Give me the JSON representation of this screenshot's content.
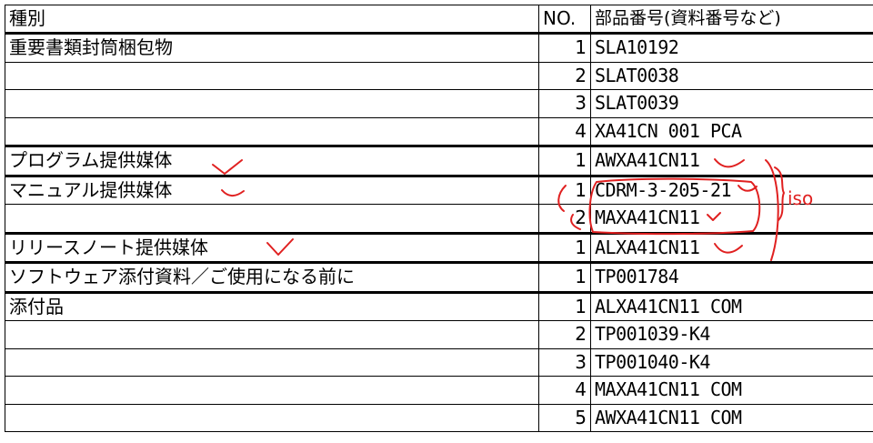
{
  "headers": {
    "type": "種別",
    "no": "NO.",
    "part": "部品番号(資料番号など)"
  },
  "rows": [
    {
      "type": "重要書類封筒梱包物",
      "no": "1",
      "part": "SLA10192"
    },
    {
      "type": "",
      "no": "2",
      "part": "SLAT0038"
    },
    {
      "type": "",
      "no": "3",
      "part": "SLAT0039"
    },
    {
      "type": "",
      "no": "4",
      "part": "XA41CN 001 PCA"
    },
    {
      "type": "プログラム提供媒体",
      "no": "1",
      "part": "AWXA41CN11"
    },
    {
      "type": "マニュアル提供媒体",
      "no": "1",
      "part": "CDRM-3-205-21"
    },
    {
      "type": "",
      "no": "2",
      "part": "MAXA41CN11"
    },
    {
      "type": "リリースノート提供媒体",
      "no": "1",
      "part": "ALXA41CN11"
    },
    {
      "type": "ソフトウェア添付資料／ご使用になる前に",
      "no": "1",
      "part": "TP001784"
    },
    {
      "type": "添付品",
      "no": "1",
      "part": "ALXA41CN11 COM"
    },
    {
      "type": "",
      "no": "2",
      "part": "TP001039-K4"
    },
    {
      "type": "",
      "no": "3",
      "part": "TP001040-K4"
    },
    {
      "type": "",
      "no": "4",
      "part": "MAXA41CN11 COM"
    },
    {
      "type": "",
      "no": "5",
      "part": "AWXA41CN11 COM"
    }
  ],
  "annotations": {
    "iso_text": "iso",
    "mark_color": "#e02020"
  }
}
